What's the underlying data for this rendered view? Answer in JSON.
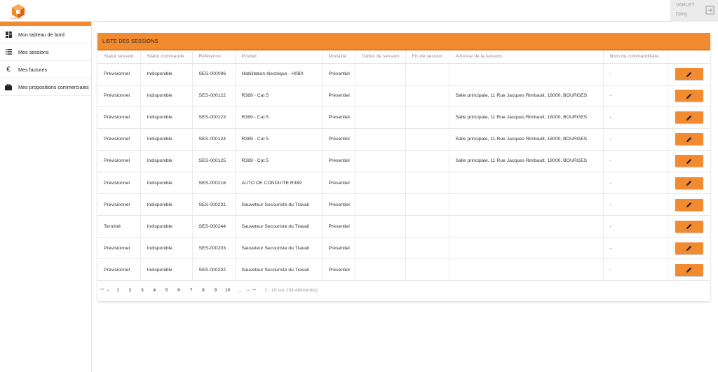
{
  "brand": {
    "logo_text": "HOME SUD",
    "accent": "#f28a30"
  },
  "user": {
    "last_name": "VARLET",
    "first_name": "Dany"
  },
  "sidebar": {
    "items": [
      {
        "icon": "dashboard-icon",
        "label": "Mon tableau de bord"
      },
      {
        "icon": "list-icon",
        "label": "Mes sessions"
      },
      {
        "icon": "euro-icon",
        "label": "Mes factures"
      },
      {
        "icon": "briefcase-icon",
        "label": "Mes propositions commerciales"
      }
    ]
  },
  "panel": {
    "title": "LISTE DES SESSIONS",
    "columns": [
      "Statut session",
      "Statut commande",
      "Référence",
      "Produit",
      "Modalité",
      "Début de session",
      "Fin de session",
      "Adresse de la session",
      "Nom du commanditaire",
      ""
    ],
    "rows": [
      [
        "Prévisionnel",
        "Indisponible",
        "SES-000096",
        "Habilitation électrique - H0B0",
        "Présentiel",
        "",
        "",
        "",
        "-"
      ],
      [
        "Prévisionnel",
        "Indisponible",
        "SES-000122",
        "R389 - Cat 5",
        "Présentiel",
        "",
        "",
        "Salle principale, 11 Rue Jacques Rimbault, 18000, BOURGES",
        "-"
      ],
      [
        "Prévisionnel",
        "Indisponible",
        "SES-000123",
        "R389 - Cat 5",
        "Présentiel",
        "",
        "",
        "Salle principale, 11 Rue Jacques Rimbault, 18000, BOURGES",
        "-"
      ],
      [
        "Prévisionnel",
        "Indisponible",
        "SES-000124",
        "R389 - Cat 5",
        "Présentiel",
        "",
        "",
        "Salle principale, 11 Rue Jacques Rimbault, 18000, BOURGES",
        "-"
      ],
      [
        "Prévisionnel",
        "Indisponible",
        "SES-000125",
        "R389 - Cat 5",
        "Présentiel",
        "",
        "",
        "Salle principale, 11 Rue Jacques Rimbault, 18000, BOURGES",
        "-"
      ],
      [
        "Prévisionnel",
        "Indisponible",
        "SES-000216",
        "AUTO DE CONDUITE R389",
        "Présentiel",
        "",
        "",
        "",
        "-"
      ],
      [
        "Prévisionnel",
        "Indisponible",
        "SES-000231",
        "Sauveteur Secouriste du Travail",
        "Présentiel",
        "",
        "",
        "",
        "-"
      ],
      [
        "Terminé",
        "Indisponible",
        "SES-000244",
        "Sauveteur Secouriste du Travail",
        "Présentiel",
        "",
        "",
        "",
        "-"
      ],
      [
        "Prévisionnel",
        "Indisponible",
        "SES-000203",
        "Sauveteur Secouriste du Travail",
        "Présentiel",
        "",
        "",
        "",
        "-"
      ],
      [
        "Prévisionnel",
        "Indisponible",
        "SES-000202",
        "Sauveteur Secouriste du Travail",
        "Présentiel",
        "",
        "",
        "",
        "-"
      ]
    ]
  },
  "pagination": {
    "first": "⏮",
    "prev": "◂",
    "pages": [
      "1",
      "2",
      "3",
      "4",
      "5",
      "6",
      "7",
      "8",
      "9",
      "10",
      "..."
    ],
    "next": "▸",
    "last": "⏭",
    "summary": "1 - 10 sur 134 élément(s)"
  }
}
